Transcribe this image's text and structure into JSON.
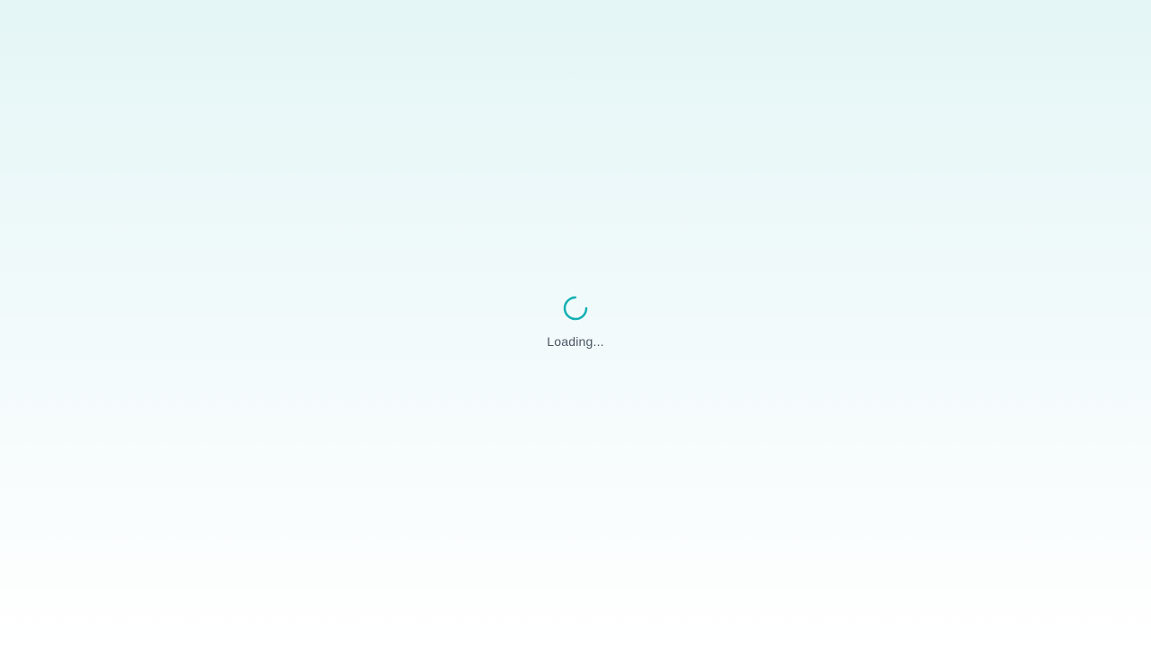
{
  "loader": {
    "icon": "spinner-icon",
    "text": "Loading...",
    "accent_color": "#14b0b4"
  }
}
